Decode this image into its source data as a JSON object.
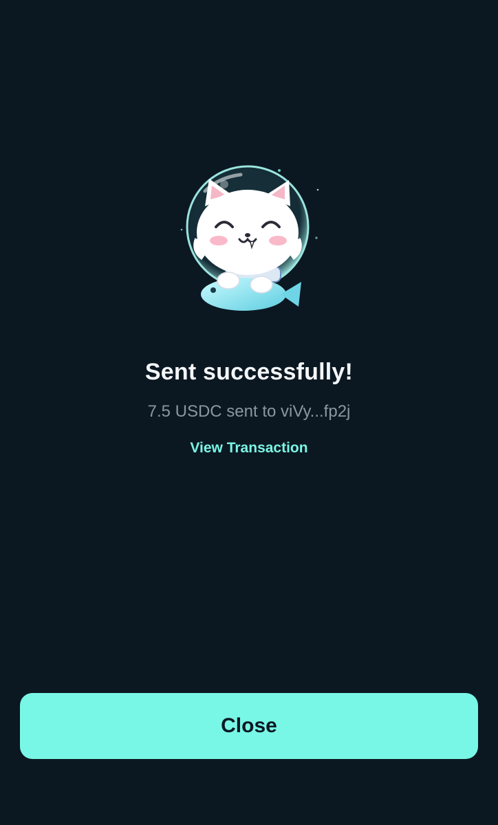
{
  "result": {
    "title": "Sent successfully!",
    "summary": "7.5 USDC sent to viVy...fp2j",
    "view_link_label": "View Transaction"
  },
  "actions": {
    "close_label": "Close"
  },
  "illustration": {
    "icon": "astronaut-cat-icon"
  },
  "colors": {
    "background": "#0b1822",
    "accent": "#79f7e6",
    "link": "#7cf5e4",
    "title": "#f4f6f8",
    "subtitle": "#8c96a0"
  }
}
